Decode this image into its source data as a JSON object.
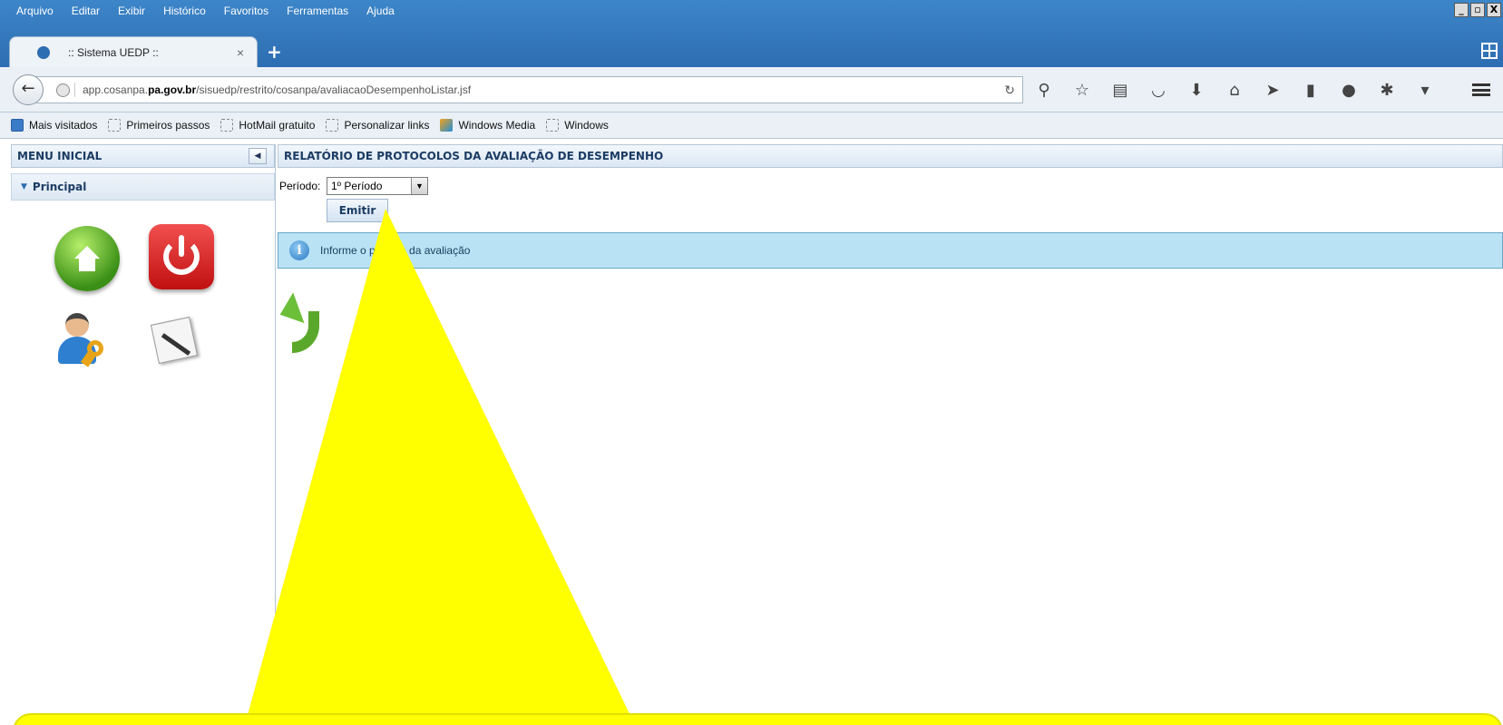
{
  "browser": {
    "menu": [
      "Arquivo",
      "Editar",
      "Exibir",
      "Histórico",
      "Favoritos",
      "Ferramentas",
      "Ajuda"
    ],
    "window_controls": [
      "_",
      "▫",
      "X"
    ],
    "tab_title": ":: Sistema UEDP ::",
    "url": {
      "prefix": "app.cosanpa.",
      "bold": "pa.gov.br",
      "path": "/sisuedp/restrito/cosanpa/avaliacaoDesempenhoListar.jsf"
    },
    "bookmarks": [
      "Mais visitados",
      "Primeiros passos",
      "HotMail gratuito",
      "Personalizar links",
      "Windows Media",
      "Windows"
    ]
  },
  "sidebar": {
    "header": "MENU INICIAL",
    "panel": "Principal"
  },
  "main": {
    "header": "RELATÓRIO DE PROTOCOLOS DA AVALIAÇÃO DE DESEMPENHO",
    "periodo_label": "Período:",
    "periodo_value": "1º Período",
    "emitir_label": "Emitir",
    "info_message": "Informe o período da avaliação"
  },
  "colors": {
    "header_text": "#1b3c63",
    "info_bg": "#b9e2f5",
    "callout": "#ffff00"
  }
}
